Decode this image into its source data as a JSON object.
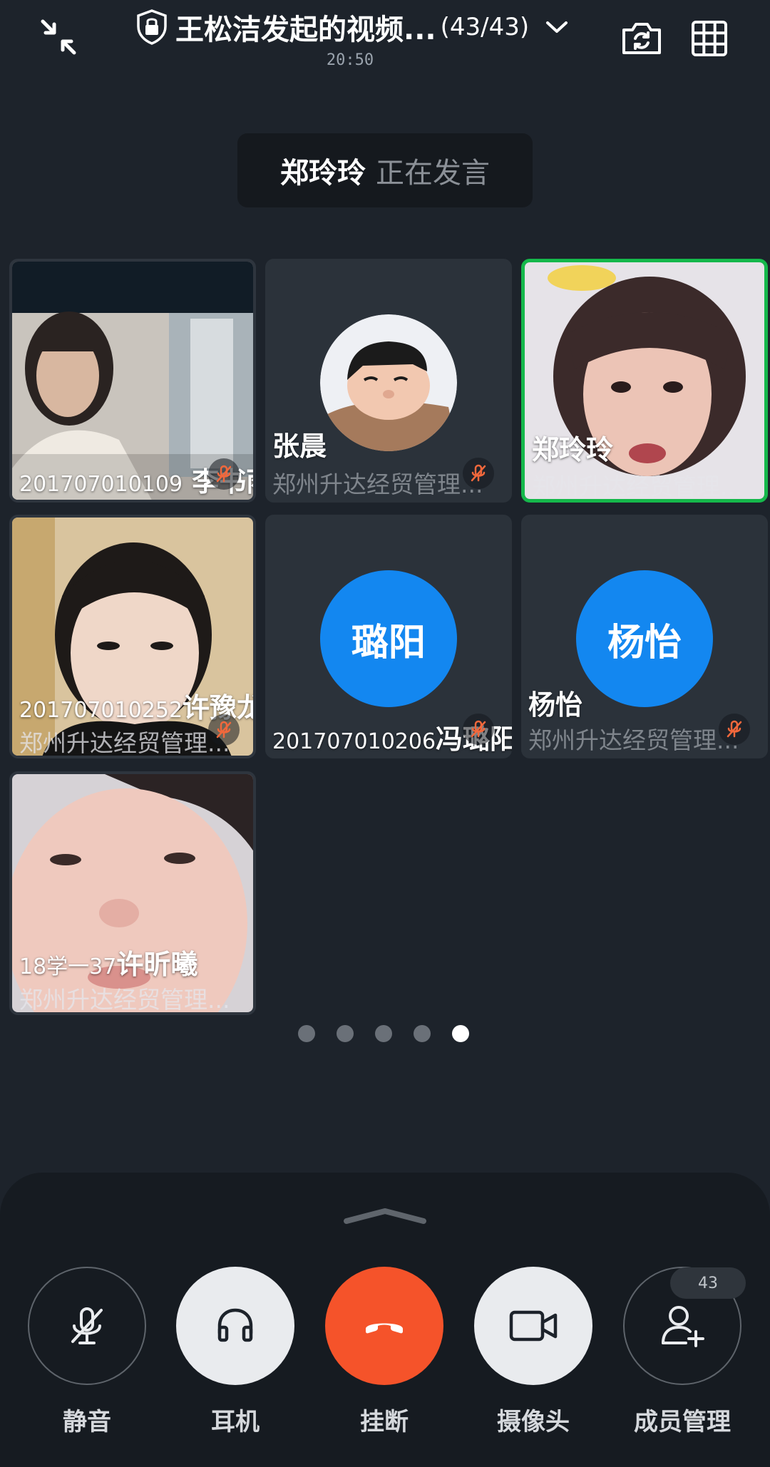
{
  "header": {
    "title": "王松洁发起的视频...",
    "count": "(43/43)",
    "time": "20:50"
  },
  "speaking": {
    "name": "郑玲玲",
    "status": "正在发言"
  },
  "tiles": [
    {
      "name_prefix": "201707010109",
      "name": "李书雨",
      "org": "",
      "muted": true,
      "type": "video"
    },
    {
      "name_prefix": "",
      "name": "张晨",
      "org": "郑州升达经贸管理...",
      "muted": true,
      "type": "avatar-image"
    },
    {
      "name_prefix": "",
      "name": "郑玲玲",
      "org": "郑州升达经贸管理...",
      "muted": false,
      "type": "video",
      "active": true
    },
    {
      "name_prefix": "201707010252",
      "name": "许豫龙",
      "org": "郑州升达经贸管理...",
      "muted": true,
      "type": "video"
    },
    {
      "name_prefix": "201707010206",
      "name": "冯璐阳",
      "org": "",
      "muted": true,
      "type": "avatar",
      "avatar_text": "璐阳",
      "avatar_color": "#1387f0"
    },
    {
      "name_prefix": "",
      "name": "杨怡",
      "org": "郑州升达经贸管理...",
      "muted": true,
      "type": "avatar",
      "avatar_text": "杨怡",
      "avatar_color": "#1387f0"
    },
    {
      "name_prefix": "18学一37",
      "name": "许昕曦",
      "org": "郑州升达经贸管理...",
      "muted": false,
      "type": "video"
    }
  ],
  "pagination": {
    "total": 5,
    "current": 5
  },
  "controls": [
    {
      "label": "静音",
      "icon": "mic-off-icon"
    },
    {
      "label": "耳机",
      "icon": "headphones-icon"
    },
    {
      "label": "挂断",
      "icon": "hang-up-icon"
    },
    {
      "label": "摄像头",
      "icon": "camera-icon"
    },
    {
      "label": "成员管理",
      "icon": "add-member-icon",
      "badge": "43"
    }
  ],
  "colors": {
    "background": "#1d232b",
    "active_border": "#15b84b",
    "hangup": "#f5532a",
    "avatar_blue": "#1387f0"
  }
}
